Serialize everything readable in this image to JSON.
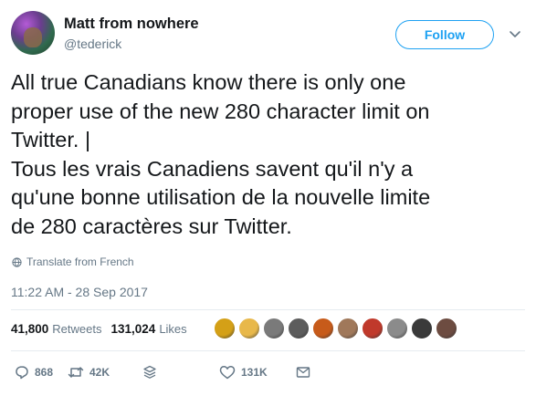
{
  "author": {
    "name": "Matt from nowhere",
    "handle": "@tederick",
    "avatar_icon": "user-avatar"
  },
  "follow_label": "Follow",
  "tweet": {
    "text": "All true Canadians know there is only one\nproper use of the new 280 character limit on\nTwitter. |\nTous les vrais Canadiens savent qu'il n'y a\nqu'une bonne utilisation de la nouvelle limite\nde 280 caractères sur Twitter.",
    "translate_label": "Translate from French",
    "timestamp": "11:22 AM - 28 Sep 2017"
  },
  "stats": {
    "retweets_count": "41,800",
    "retweets_label": "Retweets",
    "likes_count": "131,024",
    "likes_label": "Likes"
  },
  "likers": [
    "#d4a017",
    "#e8b84a",
    "#7a7a7a",
    "#5c5c5c",
    "#c75b1a",
    "#a0785a",
    "#c0392b",
    "#8b8b8b",
    "#3a3a3a",
    "#6d4c41"
  ],
  "actions": {
    "reply_count": "868",
    "retweet_count": "42K",
    "like_count": "131K"
  },
  "colors": {
    "accent": "#1da1f2",
    "secondary_text": "#657786",
    "border": "#e6ecf0"
  }
}
